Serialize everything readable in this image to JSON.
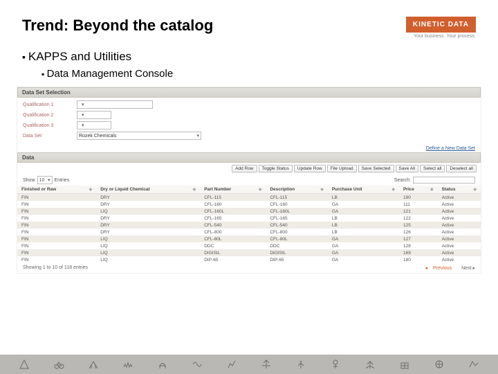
{
  "header": {
    "title": "Trend: Beyond the catalog"
  },
  "brand": {
    "name": "KINETIC DATA",
    "tagline": "Your business. Your process."
  },
  "bullets": {
    "l1": "KAPPS and Utilities",
    "l2": "Data Management Console"
  },
  "panel1": {
    "title": "Data Set Selection"
  },
  "filters": {
    "q1_label": "Qualification 1",
    "q2_label": "Qualification 2",
    "q3_label": "Qualification 3",
    "ds_label": "Data Set",
    "ds_value": "Rozek Chemicals",
    "define_link": "Define a New Data Set"
  },
  "panel2": {
    "title": "Data"
  },
  "toolbar": {
    "add_row": "Add Row",
    "toggle": "Toggle Status",
    "update": "Update Row",
    "upload": "File Upload",
    "save_sel": "Save Selected",
    "save_all": "Save All",
    "select_all": "Select all",
    "deselect_all": "Deselect all"
  },
  "show": {
    "label": "Show",
    "count": "10",
    "entries": "Entries",
    "search_label": "Search:"
  },
  "columns": {
    "c0": "Finished or Raw",
    "c1": "Dry or Liquid Chemical",
    "c2": "Part Number",
    "c3": "Description",
    "c4": "Purchase Unit",
    "c5": "Price",
    "c6": "Status"
  },
  "rows": [
    {
      "c0": "FIN",
      "c1": "DRY",
      "c2": "CFL-115",
      "c3": "CFL-115",
      "c4": "LB",
      "c5": "190",
      "c6": "Active"
    },
    {
      "c0": "FIN",
      "c1": "DRY",
      "c2": "CFL-160",
      "c3": "CFL-160",
      "c4": "GA",
      "c5": "111",
      "c6": "Active"
    },
    {
      "c0": "FIN",
      "c1": "LIQ",
      "c2": "CFL-160L",
      "c3": "CFL-160L",
      "c4": "GA",
      "c5": "121",
      "c6": "Active"
    },
    {
      "c0": "FIN",
      "c1": "DRY",
      "c2": "CFL-165",
      "c3": "CFL-165",
      "c4": "LB",
      "c5": "122",
      "c6": "Active"
    },
    {
      "c0": "FIN",
      "c1": "DRY",
      "c2": "CFL-540",
      "c3": "CFL-540",
      "c4": "LB",
      "c5": "125",
      "c6": "Active"
    },
    {
      "c0": "FIN",
      "c1": "DRY",
      "c2": "CFL-800",
      "c3": "CFL-800",
      "c4": "LB",
      "c5": "126",
      "c6": "Active"
    },
    {
      "c0": "FIN",
      "c1": "LIQ",
      "c2": "CFL-80L",
      "c3": "CFL-80L",
      "c4": "GA",
      "c5": "127",
      "c6": "Active"
    },
    {
      "c0": "FIN",
      "c1": "LIQ",
      "c2": "DDC",
      "c3": "DDC",
      "c4": "GA",
      "c5": "128",
      "c6": "Active"
    },
    {
      "c0": "FIN",
      "c1": "LIQ",
      "c2": "DIGISIL",
      "c3": "DIGISIL",
      "c4": "GA",
      "c5": "169",
      "c6": "Active"
    },
    {
      "c0": "FIN",
      "c1": "LIQ",
      "c2": "DIP-65",
      "c3": "DIP-65",
      "c4": "GA",
      "c5": "180",
      "c6": "Active"
    }
  ],
  "footer": {
    "showing": "Showing 1 to 10 of 118 entries",
    "prev": "Previous",
    "next": "Next"
  }
}
